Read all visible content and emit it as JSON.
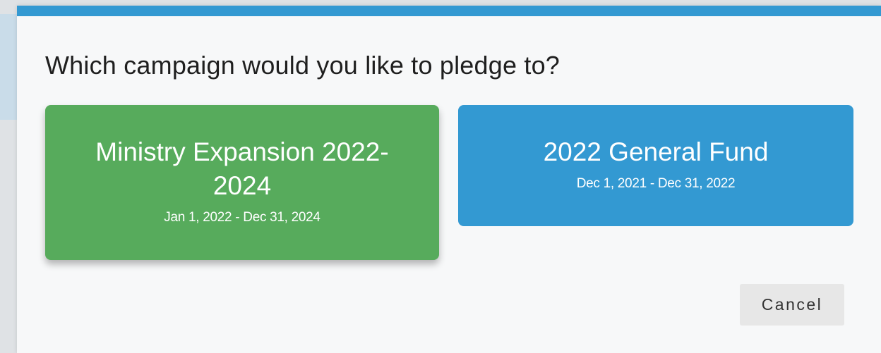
{
  "dialog": {
    "title": "Which campaign would you like to pledge to?",
    "accent_color": "#3399d2"
  },
  "campaigns": [
    {
      "name": "Ministry Expansion 2022-2024",
      "dates": "Jan 1, 2022 - Dec 31, 2024",
      "color": "#57ab5c"
    },
    {
      "name": "2022 General Fund",
      "dates": "Dec 1, 2021 - Dec 31, 2022",
      "color": "#3399d2"
    }
  ],
  "actions": {
    "cancel_label": "Cancel"
  }
}
